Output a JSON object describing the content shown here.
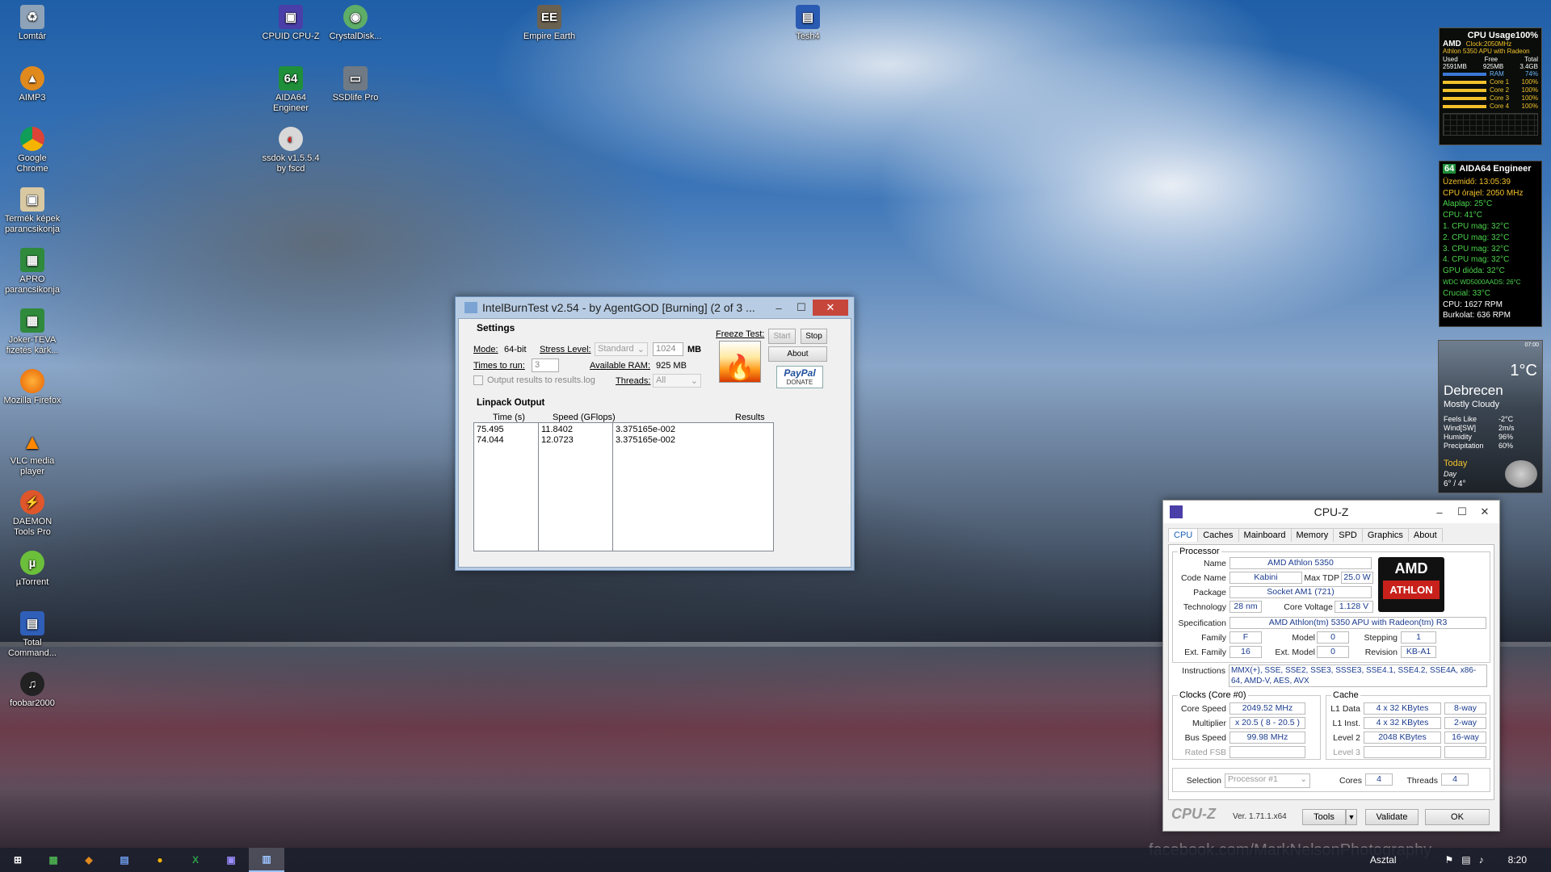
{
  "desktop": {
    "left_icons": [
      {
        "label": "Lomtár",
        "icon": "recycle-bin-icon"
      },
      {
        "label": "AIMP3",
        "icon": "aimp-icon"
      },
      {
        "label": "Google Chrome",
        "icon": "chrome-icon"
      },
      {
        "label": "Termék képek parancsikonja",
        "icon": "shortcut-icon"
      },
      {
        "label": "APRO parancsikonja",
        "icon": "spreadsheet-icon"
      },
      {
        "label": "Joker-TEVA fizetés kárk...",
        "icon": "spreadsheet-icon"
      },
      {
        "label": "Mozilla Firefox",
        "icon": "firefox-icon"
      },
      {
        "label": "VLC media player",
        "icon": "vlc-icon"
      },
      {
        "label": "DAEMON Tools Pro",
        "icon": "daemon-tools-icon"
      },
      {
        "label": "µTorrent",
        "icon": "utorrent-icon"
      },
      {
        "label": "Total Command...",
        "icon": "floppy-icon"
      },
      {
        "label": "foobar2000",
        "icon": "foobar-icon"
      }
    ],
    "other_icons": [
      {
        "label": "CPUID CPU-Z",
        "icon": "cpuz-icon"
      },
      {
        "label": "CrystalDisk...",
        "icon": "crystaldisk-icon"
      },
      {
        "label": "AIDA64 Engineer",
        "icon": "aida64-icon"
      },
      {
        "label": "SSDlife Pro",
        "icon": "ssdlife-icon"
      },
      {
        "label": "ssdok v1.5.5.4 by fscd",
        "icon": "ssdok-icon"
      },
      {
        "label": "Empire Earth",
        "icon": "empire-earth-icon"
      },
      {
        "label": "Tesh4",
        "icon": "tesh-icon"
      }
    ],
    "watermark": "facebook.com/MarkNelsonPhotography"
  },
  "ibt": {
    "title": "IntelBurnTest v2.54 - by AgentGOD [Burning] (2 of 3 ...",
    "settings_title": "Settings",
    "mode_label": "Mode:",
    "mode_value": "64-bit",
    "stress_label": "Stress Level:",
    "stress_value": "Standard",
    "ram_value": "1024",
    "ram_unit": "MB",
    "times_label": "Times to run:",
    "times_value": "3",
    "avail_label": "Available RAM:",
    "avail_value": "925 MB",
    "output_checkbox": "Output results to results.log",
    "threads_label": "Threads:",
    "threads_value": "All",
    "freeze_label": "Freeze Test:",
    "start": "Start",
    "stop": "Stop",
    "about": "About",
    "paypal": "PayPal",
    "donate": "DONATE",
    "linpack_title": "Linpack Output",
    "col_time": "Time (s)",
    "col_speed": "Speed (GFlops)",
    "col_results": "Results",
    "times": [
      "75.495",
      "74.044"
    ],
    "speeds": [
      "11.8402",
      "12.0723"
    ],
    "results": [
      "3.375165e-002",
      "3.375165e-002"
    ]
  },
  "cpuz": {
    "title": "CPU-Z",
    "tabs": [
      "CPU",
      "Caches",
      "Mainboard",
      "Memory",
      "SPD",
      "Graphics",
      "About"
    ],
    "processor_group": "Processor",
    "name_k": "Name",
    "name_v": "AMD Athlon 5350",
    "code_k": "Code Name",
    "code_v": "Kabini",
    "tdp_k": "Max TDP",
    "tdp_v": "25.0 W",
    "pkg_k": "Package",
    "pkg_v": "Socket AM1 (721)",
    "tech_k": "Technology",
    "tech_v": "28 nm",
    "volt_k": "Core Voltage",
    "volt_v": "1.128 V",
    "spec_k": "Specification",
    "spec_v": "AMD Athlon(tm) 5350 APU with Radeon(tm) R3",
    "fam_k": "Family",
    "fam_v": "F",
    "model_k": "Model",
    "model_v": "0",
    "step_k": "Stepping",
    "step_v": "1",
    "efam_k": "Ext. Family",
    "efam_v": "16",
    "emodel_k": "Ext. Model",
    "emodel_v": "0",
    "rev_k": "Revision",
    "rev_v": "KB-A1",
    "instr_k": "Instructions",
    "instr_v": "MMX(+), SSE, SSE2, SSE3, SSSE3, SSE4.1, SSE4.2, SSE4A, x86-64, AMD-V, AES, AVX",
    "clocks_group": "Clocks (Core #0)",
    "cs_k": "Core Speed",
    "cs_v": "2049.52 MHz",
    "mult_k": "Multiplier",
    "mult_v": "x 20.5 ( 8 - 20.5 )",
    "bus_k": "Bus Speed",
    "bus_v": "99.98 MHz",
    "fsb_k": "Rated FSB",
    "cache_group": "Cache",
    "l1d_k": "L1 Data",
    "l1d_v": "4 x 32 KBytes",
    "l1d_w": "8-way",
    "l1i_k": "L1 Inst.",
    "l1i_v": "4 x 32 KBytes",
    "l1i_w": "2-way",
    "l2_k": "Level 2",
    "l2_v": "2048 KBytes",
    "l2_w": "16-way",
    "l3_k": "Level 3",
    "selection_k": "Selection",
    "selection_v": "Processor #1",
    "cores_k": "Cores",
    "cores_v": "4",
    "threads_k": "Threads",
    "threads_v": "4",
    "brand": "CPU-Z",
    "version": "Ver. 1.71.1.x64",
    "tools": "Tools",
    "validate": "Validate",
    "ok": "OK",
    "logo_top": "AMD",
    "logo_bottom": "ATHLON"
  },
  "gadget_cpu": {
    "title": "CPU Usage100%",
    "brand": "AMD",
    "clock": "Clock:2050MHz",
    "model": "Athlon 5350 APU with Radeon",
    "used_k": "Used",
    "free_k": "Free",
    "total_k": "Total",
    "used_v": "2591MB",
    "free_v": "925MB",
    "total_v": "3.4GB",
    "ram_k": "RAM",
    "ram_v": "74%",
    "cores": [
      {
        "label": "Core 1",
        "value": "100%"
      },
      {
        "label": "Core 2",
        "value": "100%"
      },
      {
        "label": "Core 3",
        "value": "100%"
      },
      {
        "label": "Core 4",
        "value": "100%"
      }
    ]
  },
  "gadget_aida": {
    "title": "AIDA64 Engineer",
    "lines": [
      "Üzemidő: 13:05:39",
      "CPU órajel: 2050 MHz",
      "Alaplap: 25°C",
      "CPU: 41°C",
      "1. CPU mag: 32°C",
      "2. CPU mag: 32°C",
      "3. CPU mag: 32°C",
      "4. CPU mag: 32°C",
      "GPU dióda: 32°C",
      "WDC WD5000AADS: 26°C",
      "Crucial: 33°C",
      "CPU: 1627 RPM",
      "Burkolat: 636 RPM"
    ]
  },
  "gadget_weather": {
    "time": "07:00",
    "temp": "1°C",
    "city": "Debrecen",
    "condition": "Mostly Cloudy",
    "feels_k": "Feels Like",
    "feels_v": "-2°C",
    "wind_k": "Wind[SW]",
    "wind_v": "2m/s",
    "hum_k": "Humidity",
    "hum_v": "96%",
    "prec_k": "Precipitation",
    "prec_v": "60%",
    "today": "Today",
    "day": "Day",
    "range": "6° / 4°"
  },
  "taskbar": {
    "items": [
      "start-icon",
      "spreadsheet-icon",
      "aimp-icon",
      "floppy-icon",
      "chrome-icon",
      "excel-icon",
      "cpuz-icon",
      "intelburntest-icon"
    ],
    "lang": "Asztal",
    "clock": "8:20"
  }
}
